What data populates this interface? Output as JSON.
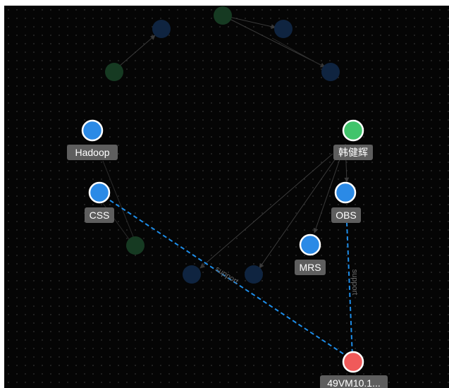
{
  "graph": {
    "nodes": {
      "hadoop": {
        "label": "Hadoop",
        "color": "#2b8ae6"
      },
      "css": {
        "label": "CSS",
        "color": "#2b8ae6"
      },
      "person": {
        "label": "韩健辉",
        "color": "#41c46b"
      },
      "obs": {
        "label": "OBS",
        "color": "#2b8ae6"
      },
      "mrs": {
        "label": "MRS",
        "color": "#2b8ae6"
      },
      "vm": {
        "label": "49VM10.1...",
        "color": "#f05a5a"
      }
    },
    "edges": {
      "css_vm": {
        "label": "support"
      },
      "obs_vm": {
        "label": "support"
      }
    },
    "faded_node_colors": {
      "blue": "#0f2440",
      "green": "#163a22"
    }
  }
}
